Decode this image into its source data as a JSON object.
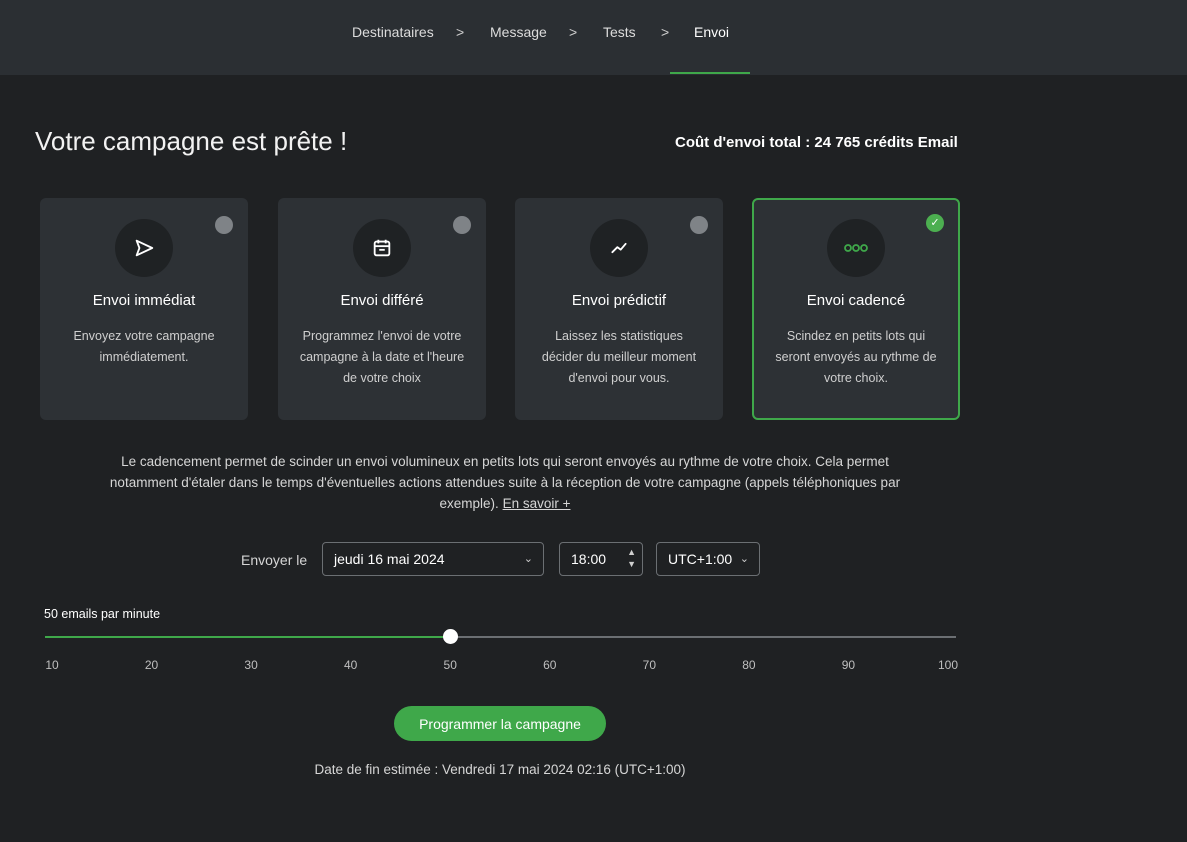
{
  "nav": {
    "steps": [
      "Destinataires",
      "Message",
      "Tests",
      "Envoi"
    ],
    "separator": ">",
    "active_step": "Envoi",
    "accent_color": "#3fa84a"
  },
  "header": {
    "title": "Votre campagne est prête !",
    "cost": "Coût d'envoi total : 24 765 crédits Email"
  },
  "cards": [
    {
      "title": "Envoi immédiat",
      "description": "Envoyez votre campagne immédiatement.",
      "icon": "send-icon",
      "selected": false
    },
    {
      "title": "Envoi différé",
      "description": "Programmez l'envoi de votre campagne à la date et l'heure de votre choix",
      "icon": "calendar-icon",
      "selected": false
    },
    {
      "title": "Envoi prédictif",
      "description": "Laissez les statistiques décider du meilleur moment d'envoi pour vous.",
      "icon": "trend-icon",
      "selected": false
    },
    {
      "title": "Envoi cadencé",
      "description": "Scindez en petits lots qui seront envoyés au rythme de votre choix.",
      "icon": "dots-icon",
      "selected": true
    }
  ],
  "explanation": {
    "text": "Le cadencement permet de scinder un envoi volumineux en petits lots qui seront envoyés au rythme de votre choix. Cela permet notamment d'étaler dans le temps d'éventuelles actions attendues suite à la réception de votre campagne (appels téléphoniques par exemple).",
    "link": "En savoir +"
  },
  "schedule": {
    "label": "Envoyer le",
    "date": "jeudi 16 mai 2024",
    "time": "18:00",
    "timezone": "UTC+1:00"
  },
  "rate": {
    "label": "50 emails par minute",
    "value": 50,
    "min": 10,
    "max": 100,
    "ticks": [
      "10",
      "20",
      "30",
      "40",
      "50",
      "60",
      "70",
      "80",
      "90",
      "100"
    ]
  },
  "cta_label": "Programmer la campagne",
  "end_date": "Date de fin estimée : Vendredi 17 mai 2024 02:16 (UTC+1:00)"
}
